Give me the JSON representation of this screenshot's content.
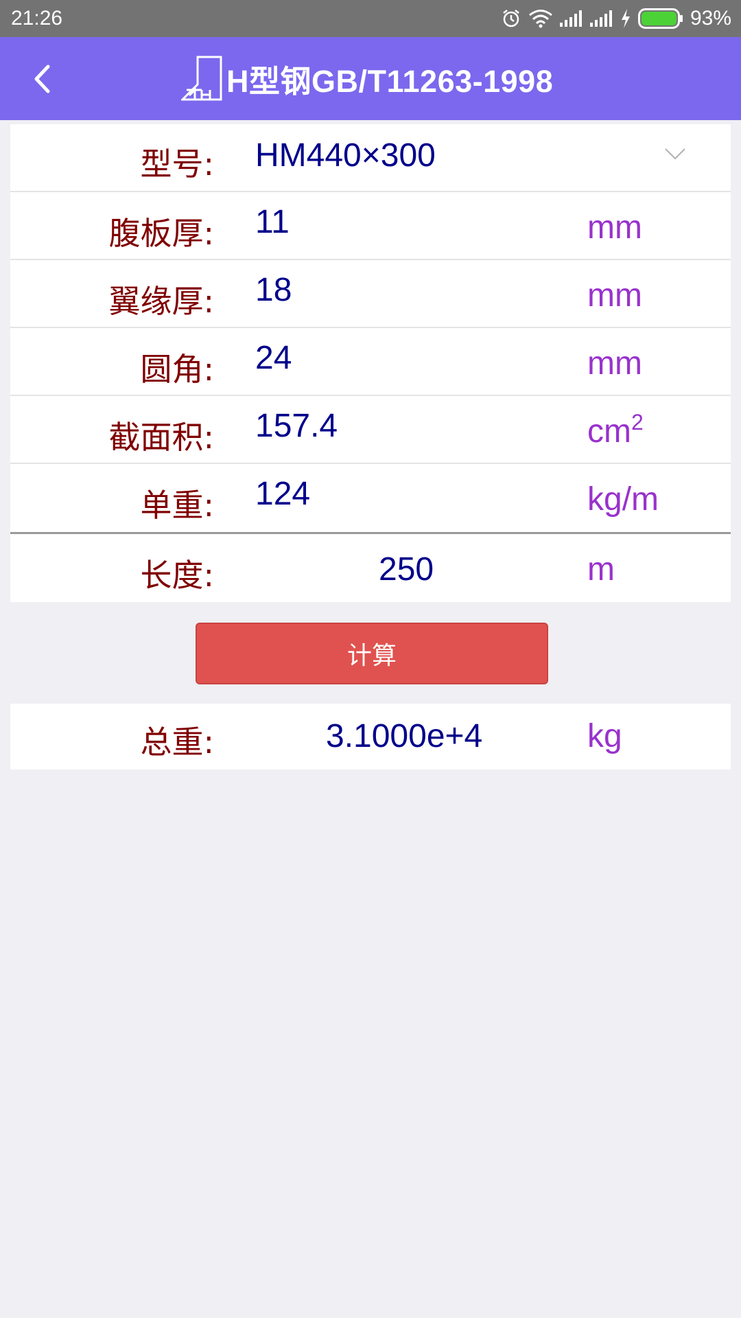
{
  "status_bar": {
    "time": "21:26",
    "battery_percent": "93%",
    "icons": [
      "alarm-icon",
      "wifi-icon",
      "signal-icon",
      "signal-icon",
      "charging-icon",
      "battery-icon"
    ]
  },
  "header": {
    "title": "H型钢GB/T11263-1998",
    "back_icon": "chevron-left-icon",
    "logo_icon": "steel-section-icon",
    "background": "#7b68ee"
  },
  "form": {
    "model": {
      "label": "型号:",
      "value": "HM440×300"
    },
    "web_thickness": {
      "label": "腹板厚:",
      "value": "11",
      "unit": "mm"
    },
    "flange_thickness": {
      "label": "翼缘厚:",
      "value": "18",
      "unit": "mm"
    },
    "fillet_radius": {
      "label": "圆角:",
      "value": "24",
      "unit": "mm"
    },
    "section_area": {
      "label": "截面积:",
      "value": "157.4",
      "unit": "cm",
      "unit_sup": "2"
    },
    "unit_weight": {
      "label": "单重:",
      "value": "124",
      "unit": "kg/m"
    },
    "length": {
      "label": "长度:",
      "value": "250",
      "unit": "m"
    }
  },
  "calculate_button": {
    "label": "计算",
    "color": "#e0524f"
  },
  "result": {
    "label": "总重:",
    "value": "3.1000e+4",
    "unit": "kg"
  },
  "colors": {
    "label": "#800000",
    "value": "#00008b",
    "unit": "#9932cc",
    "page_background": "#efeff4"
  }
}
